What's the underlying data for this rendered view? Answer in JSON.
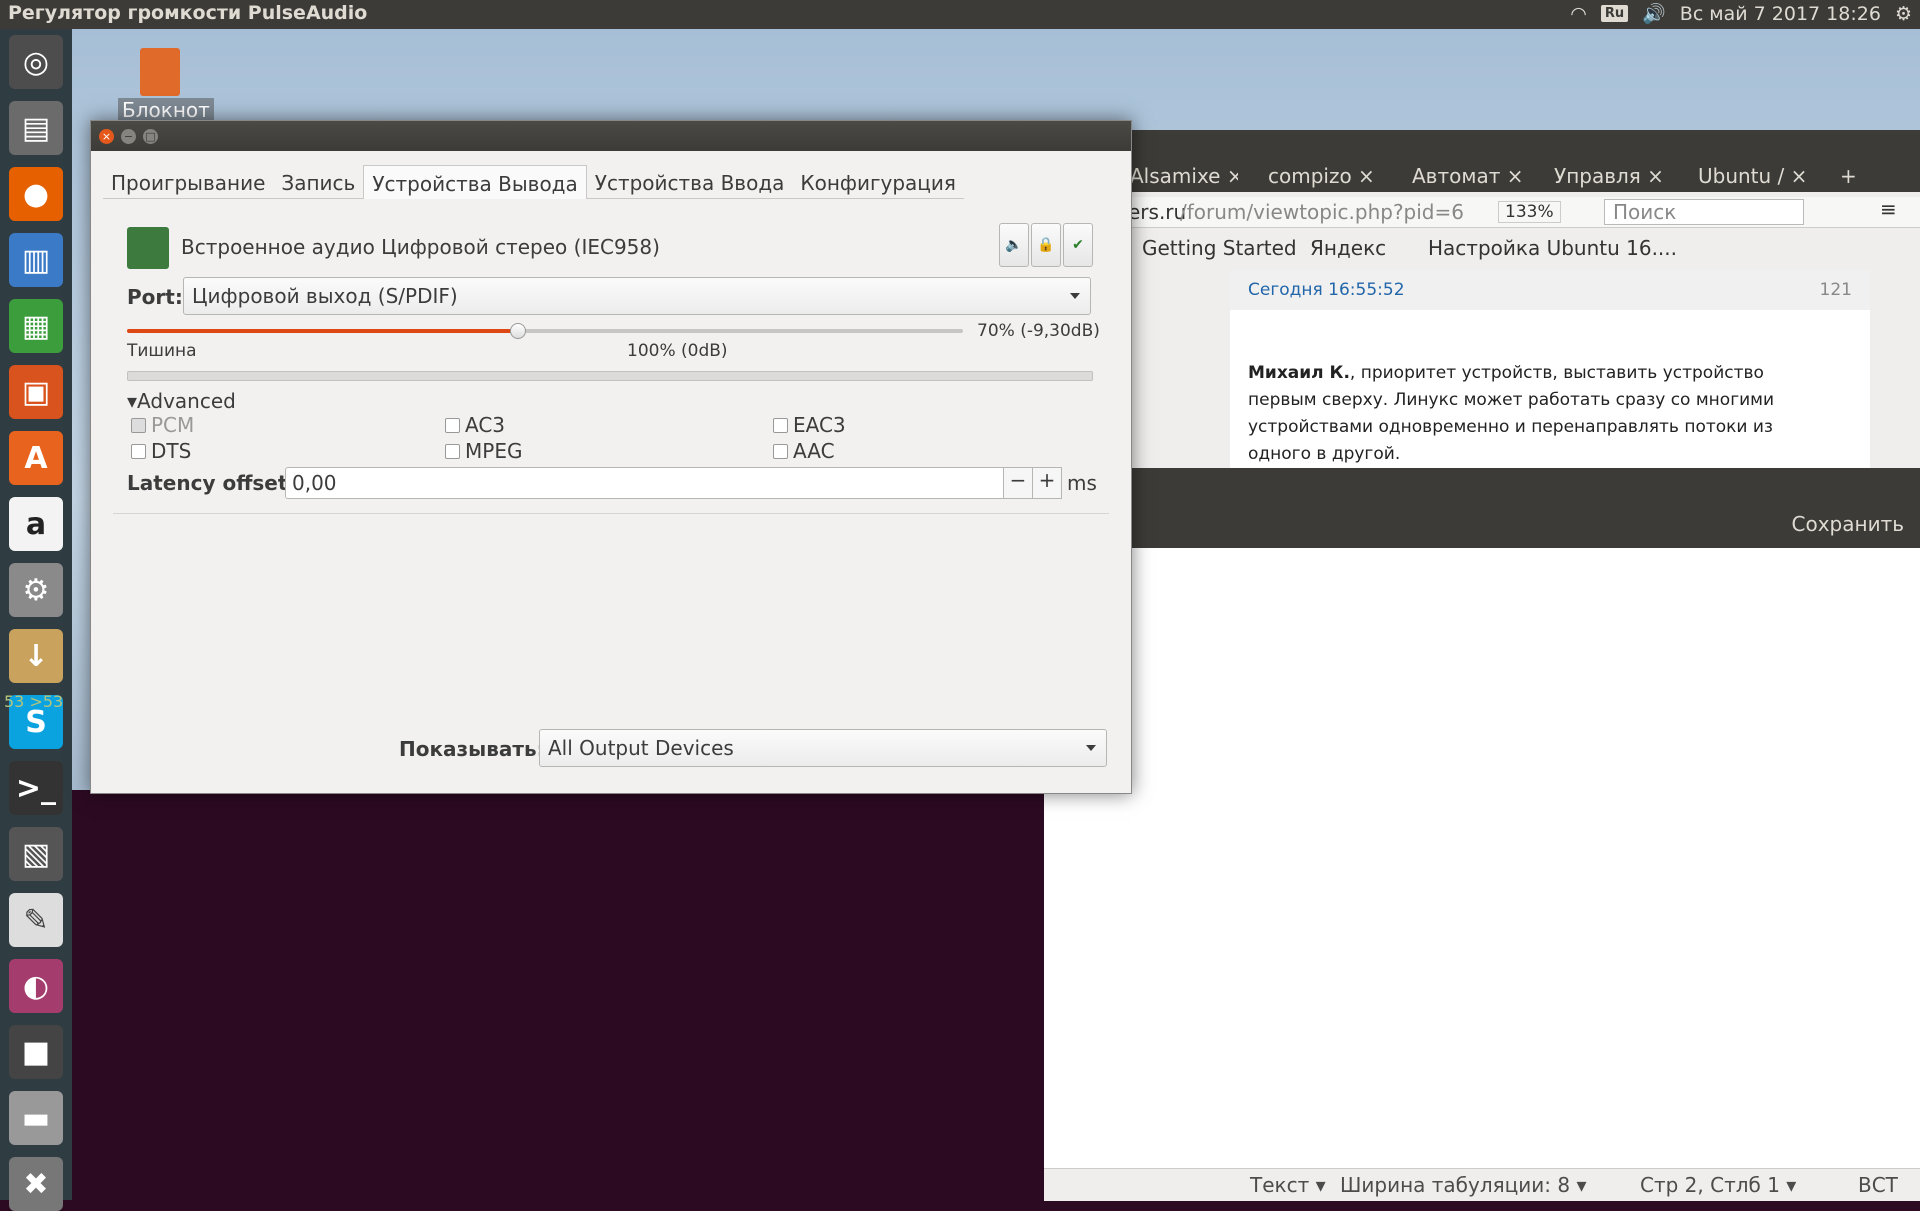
{
  "top_panel": {
    "title": "Регулятор громкости PulseAudio",
    "keyboard_layout": "Ru",
    "datetime": "Вс май  7 2017 18:26"
  },
  "desktop": {
    "icon_label": "Блокнот",
    "terminal_fragment": "53 >53"
  },
  "browser": {
    "tabs": [
      "Alsamixe",
      "compizo",
      "Автомат",
      "Управля",
      "Ubuntu /"
    ],
    "new_tab": "+",
    "url_host": "ers.ru",
    "url_path": "/forum/viewtopic.php?pid=6",
    "zoom": "133%",
    "search_placeholder": "Поиск",
    "bookmarks": [
      "Getting Started",
      "Яндекс",
      "Настройка Ubuntu 16...."
    ],
    "post": {
      "time": "Сегодня 16:55:52",
      "number": "121",
      "author": "Михаил К.",
      "text": ", приоритет устройств, выставить устройство первым сверху. Линукс может работать сразу со многими устройствами одновременно и перенаправлять потоки из одного в другой."
    }
  },
  "editor": {
    "save_label": "Сохранить",
    "status": {
      "mode": "Текст",
      "tab_width": "Ширина табуляции: 8",
      "position": "Стр 2, Стлб 1",
      "insert": "ВСТ"
    }
  },
  "pavucontrol": {
    "tabs": [
      "Проигрывание",
      "Запись",
      "Устройства Вывода",
      "Устройства Ввода",
      "Конфигурация"
    ],
    "active_tab": "Устройства Вывода",
    "device_name": "Встроенное аудио Цифровой стерео (IEC958)",
    "port_label": "Port:",
    "port_value": "Цифровой выход (S/PDIF)",
    "volume_fraction": 0.7,
    "volume_text": "70% (-9,30dB)",
    "silence_label": "Тишина",
    "hundred_label": "100% (0dB)",
    "advanced_label": "Advanced",
    "formats": [
      {
        "label": "PCM",
        "checked": true,
        "disabled": true
      },
      {
        "label": "AC3",
        "checked": false
      },
      {
        "label": "EAC3",
        "checked": false
      },
      {
        "label": "DTS",
        "checked": false
      },
      {
        "label": "MPEG",
        "checked": false
      },
      {
        "label": "AAC",
        "checked": false
      }
    ],
    "latency_label": "Latency offset:",
    "latency_value": "0,00",
    "latency_unit": "ms",
    "minus": "−",
    "plus": "+",
    "show_label": "Показывать:",
    "show_value": "All Output Devices"
  },
  "colors": {
    "panel": "#3c3b37",
    "launcher": "#2f3c42",
    "accent": "#dd4814",
    "link": "#2266aa"
  }
}
